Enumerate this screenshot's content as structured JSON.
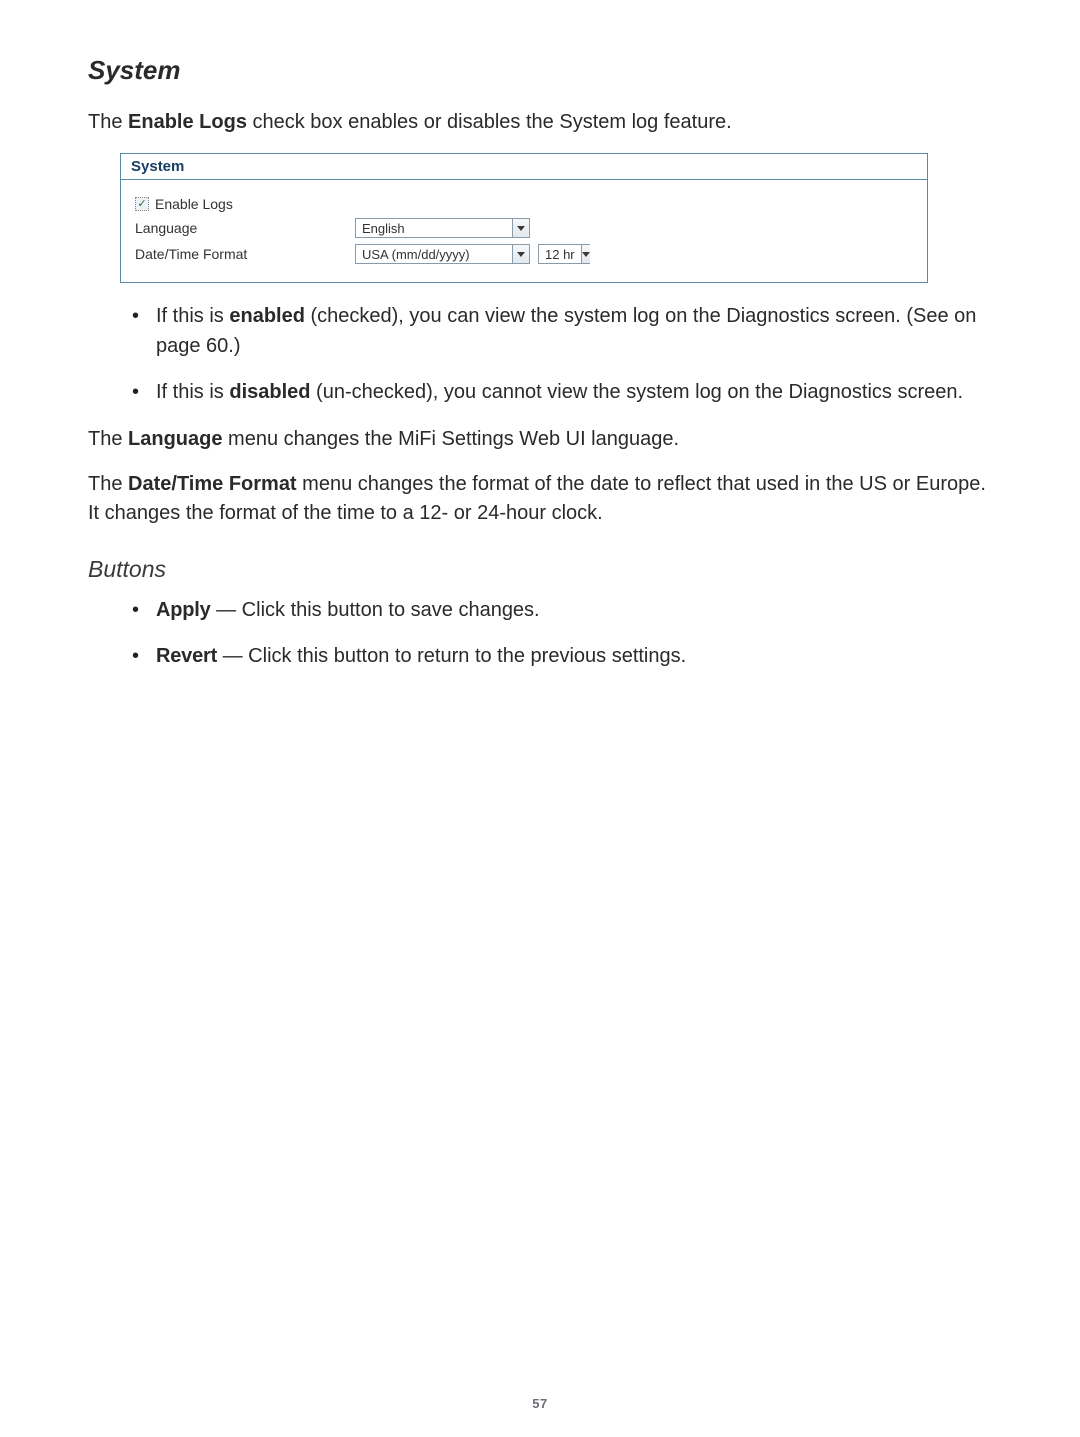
{
  "heading_system": "System",
  "intro": {
    "prefix": "The ",
    "bold": "Enable Logs",
    "suffix": " check box enables or disables the System log feature."
  },
  "panel": {
    "title": "System",
    "enable_logs_label": "Enable Logs",
    "language_label": "Language",
    "language_value": "English",
    "date_format_label": "Date/Time Format",
    "date_format_value": "USA (mm/dd/yyyy)",
    "clock_value": "12 hr"
  },
  "bullets_enable": [
    {
      "prefix": "If this is ",
      "bold": "enabled",
      "suffix": " (checked), you can view the system log on the Diagnostics screen. (See  on page 60.)"
    },
    {
      "prefix": "If this is ",
      "bold": "disabled",
      "suffix": " (un-checked), you cannot view the system log on the Diagnostics screen."
    }
  ],
  "language_para": {
    "prefix": "The ",
    "bold": "Language",
    "suffix": " menu changes the MiFi Settings Web UI language."
  },
  "dateformat_para": {
    "prefix": "The ",
    "bold": "Date/Time Format",
    "suffix": " menu changes the format of the date to reflect that used in the US or Europe. It changes the format of the time to a 12- or 24-hour clock."
  },
  "heading_buttons": "Buttons",
  "bullets_buttons": [
    {
      "bold": "Apply",
      "suffix": " — Click this button to save changes."
    },
    {
      "bold": "Revert",
      "suffix": " — Click this button to return to the previous settings."
    }
  ],
  "page_number": "57"
}
